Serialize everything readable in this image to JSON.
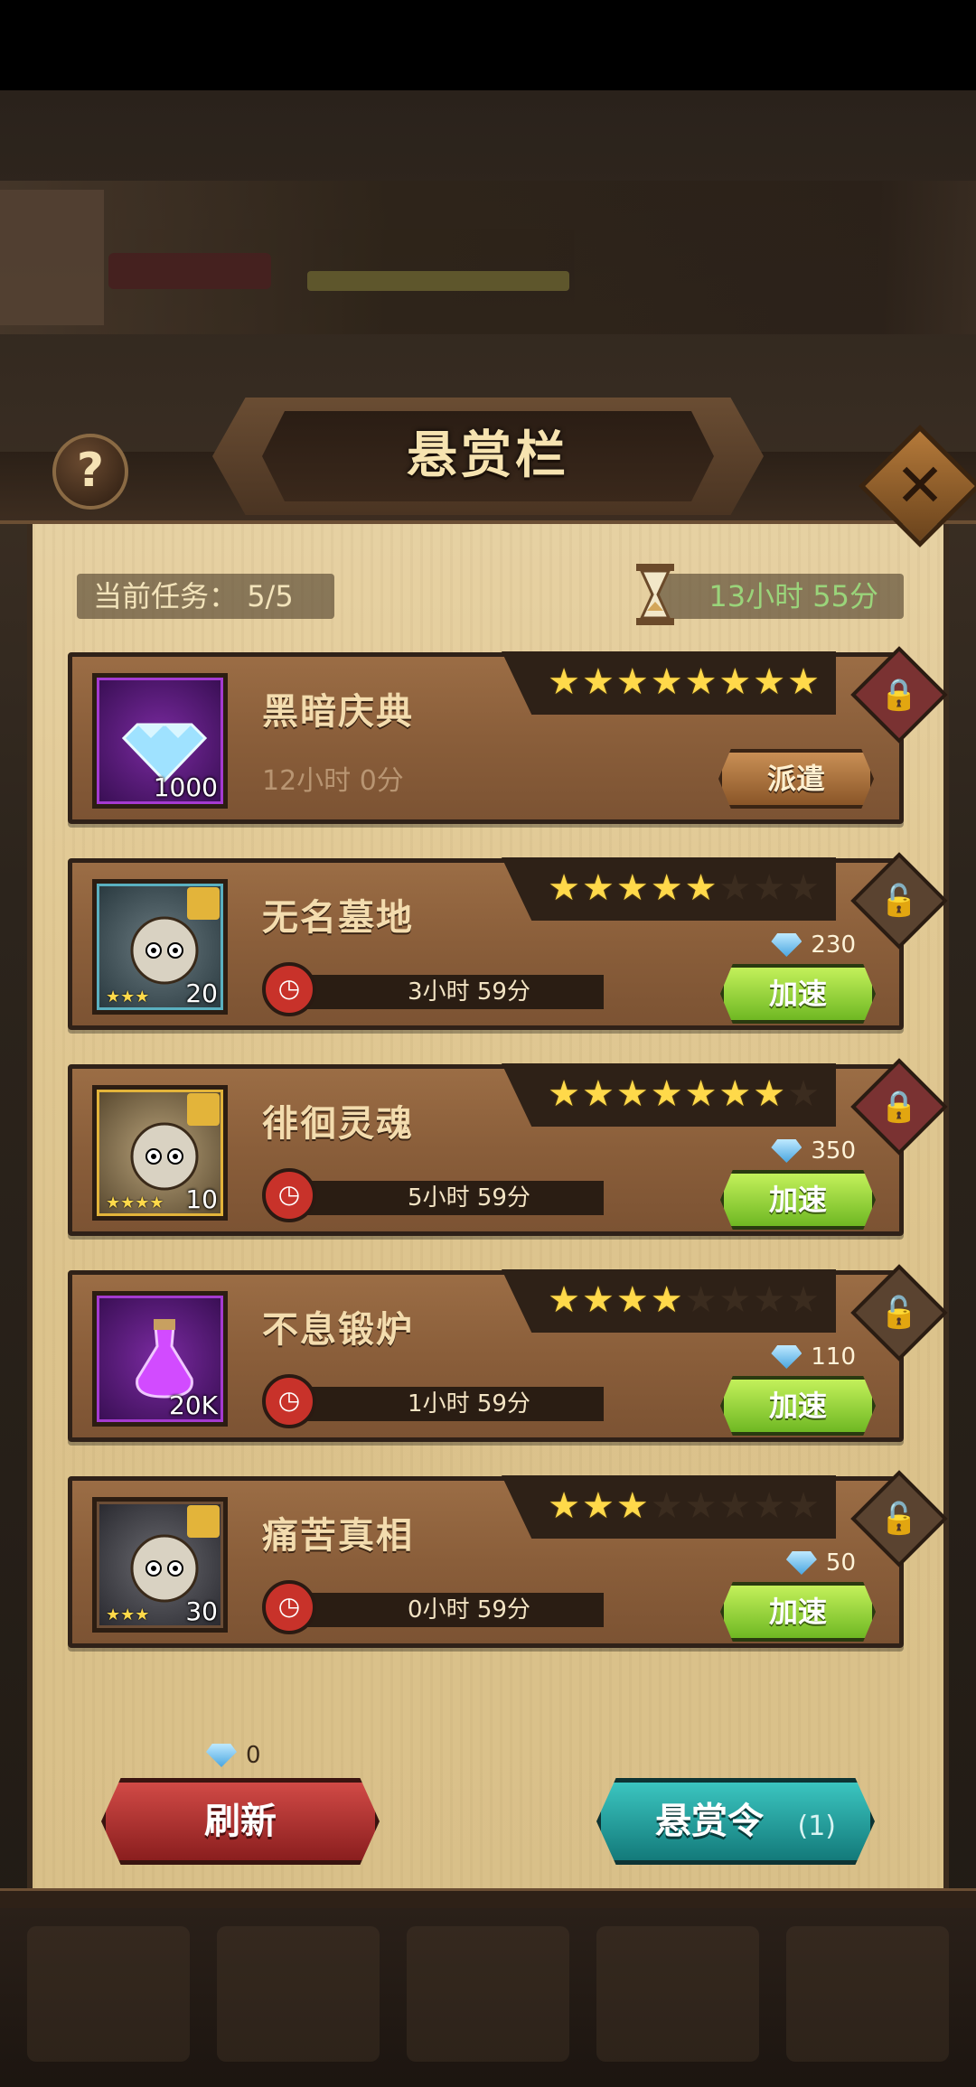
{
  "header": {
    "title": "悬赏栏",
    "help_label": "?",
    "close_label": "✕"
  },
  "summary": {
    "current_tasks_label": "当前任务：",
    "current_tasks_value": "5/5",
    "refresh_timer": "13小时 55分"
  },
  "bounties": [
    {
      "name": "黑暗庆典",
      "item_qty": "1000",
      "stars_filled": 8,
      "stars_total": 8,
      "locked": true,
      "duration": "12小时 0分",
      "action": "派遣",
      "frame": "purple"
    },
    {
      "name": "无名墓地",
      "item_qty": "20",
      "item_stars": "★★★",
      "stars_filled": 5,
      "stars_total": 8,
      "locked": false,
      "timer": "3小时 59分",
      "gem_cost": "230",
      "action": "加速",
      "frame": "teal"
    },
    {
      "name": "徘徊灵魂",
      "item_qty": "10",
      "item_stars": "★★★★",
      "stars_filled": 7,
      "stars_total": 8,
      "locked": true,
      "timer": "5小时 59分",
      "gem_cost": "350",
      "action": "加速",
      "frame": "gold"
    },
    {
      "name": "不息锻炉",
      "item_qty": "20K",
      "stars_filled": 4,
      "stars_total": 8,
      "locked": false,
      "timer": "1小时 59分",
      "gem_cost": "110",
      "action": "加速",
      "frame": "purple"
    },
    {
      "name": "痛苦真相",
      "item_qty": "30",
      "item_stars": "★★★",
      "stars_filled": 3,
      "stars_total": 8,
      "locked": false,
      "timer": "0小时 59分",
      "gem_cost": "50",
      "action": "加速",
      "frame": "brown"
    }
  ],
  "footer": {
    "refresh_cost": "0",
    "refresh_label": "刷新",
    "bounty_order_label": "悬赏令",
    "bounty_order_count": "(1)"
  },
  "colors": {
    "gold_star": "#ffd94a",
    "speed_green": "#8bd43a",
    "refresh_red": "#c03a36",
    "bounty_teal": "#2aa7a4"
  }
}
